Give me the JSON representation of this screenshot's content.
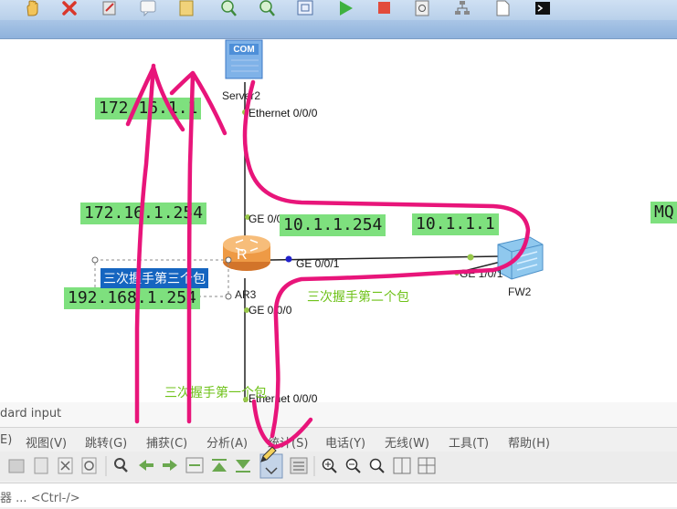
{
  "canvas": {
    "labels": {
      "ip_172_16_1_1": "172.16.1.1",
      "ip_172_16_1_254": "172.16.1.254",
      "ip_192_168_1_254": "192.168.1.254",
      "ip_10_1_1_254": "10.1.1.254",
      "ip_10_1_1_1": "10.1.1.1",
      "mq": "MQ"
    },
    "devices": {
      "server2": "Server2",
      "server2_icon_text": "COM",
      "ar3": "AR3",
      "ar3_icon_text": "R",
      "fw2": "FW2"
    },
    "ports": {
      "server2_eth": "Ethernet 0/0/0",
      "ar3_ge002": "GE 0/0/2",
      "ar3_ge001": "GE 0/0/1",
      "ar3_ge000": "GE 0/0/0",
      "fw2_ge101": "GE 1/0/1",
      "bottom_eth": "Ethernet 0/0/0"
    },
    "notes": {
      "third_packet": "三次握手第三个包",
      "second_packet": "三次握手第二个包",
      "first_packet": "三次握手第一个包"
    }
  },
  "wireshark": {
    "filter_hint": "dard input",
    "menus": [
      "E)",
      "视图(V)",
      "跳转(G)",
      "捕获(C)",
      "分析(A)",
      "统计(S)",
      "电话(Y)",
      "无线(W)",
      "工具(T)",
      "帮助(H)"
    ],
    "status_text": "器 ... <Ctrl-/>"
  },
  "colors": {
    "label_bg": "#7ee07e",
    "note_green": "#6fc21a",
    "annotation_pink": "#e8157a",
    "selection_blue": "#1565c0"
  }
}
